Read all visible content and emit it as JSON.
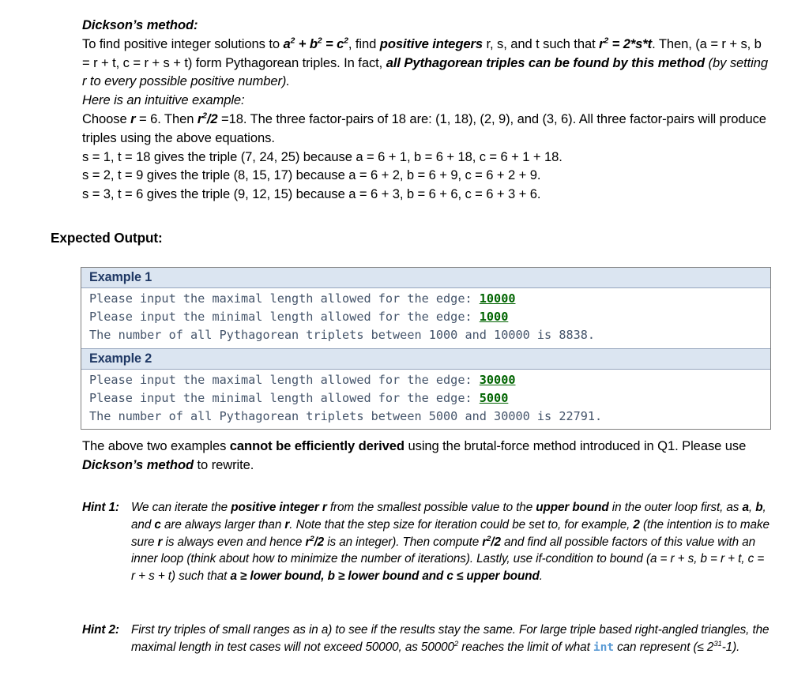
{
  "document": {
    "method": {
      "title": "Dickson’s method:",
      "line1_a": "To find positive integer solutions to ",
      "line1_eq1": "a",
      "line1_eq1_sup": "2",
      "line1_eq2": " + b",
      "line1_eq2_sup": "2",
      "line1_eq3": " = c",
      "line1_eq3_sup": "2",
      "line1_b": ", find ",
      "line1_strong": "positive integers",
      "line1_c": " r, s, and t such that ",
      "line1_eq4": "r",
      "line1_eq4_sup": "2",
      "line1_eq5": " = 2*s*t",
      "line1_d": ". Then, (a = r + s, b = r + t, c = r + s + t) form Pythagorean triples. In fact, ",
      "line1_strong2": "all Pythagorean triples can be found by this method",
      "line1_e": " (by setting r to every possible positive number).",
      "intuitive": "Here is an intuitive example:",
      "choose_a": "Choose ",
      "choose_r": "r",
      "choose_b": " = 6. Then ",
      "choose_r2": "r",
      "choose_r2_sup": "2",
      "choose_half": "/2",
      "choose_c": " =18. The three factor-pairs of 18 are: (1, 18), (2, 9), and (3, 6). All three factor-pairs will produce triples using the above equations.",
      "s_line_1": "s = 1, t = 18 gives the triple (7, 24, 25) because a = 6 + 1, b = 6 + 18, c = 6 + 1 + 18.",
      "s_line_2": "s = 2, t = 9 gives the triple (8, 15, 17) because a = 6 + 2, b = 6 + 9, c = 6 + 2 + 9.",
      "s_line_3": "s = 3, t = 6 gives the triple (9, 12, 15) because a = 6 + 3, b = 6 + 6, c = 6 + 3 + 6."
    },
    "expected_output_heading": "Expected Output:",
    "examples": [
      {
        "header": "Example 1",
        "lines": [
          {
            "prompt": "Please input the maximal length allowed for the edge: ",
            "value": "10000"
          },
          {
            "prompt": "Please input the minimal length allowed for the edge: ",
            "value": "1000"
          },
          {
            "prompt": "The number of all Pythagorean triplets between 1000 and 10000 is 8838.",
            "value": ""
          }
        ]
      },
      {
        "header": "Example 2",
        "lines": [
          {
            "prompt": "Please input the maximal length allowed for the edge: ",
            "value": "30000"
          },
          {
            "prompt": "Please input the minimal length allowed for the edge: ",
            "value": "5000"
          },
          {
            "prompt": "The number of all Pythagorean triplets between 5000 and 30000 is 22791.",
            "value": ""
          }
        ]
      }
    ],
    "below_paragraph": {
      "a": "The above two examples ",
      "bold": "cannot be efficiently derived",
      "b": " using the brutal-force method introduced in Q1. Please use ",
      "bolditalic": "Dickson’s method",
      "c": " to rewrite."
    },
    "hints": [
      {
        "label": "Hint 1:",
        "a": "We can iterate the ",
        "b1": "positive integer r",
        "b": " from the smallest possible value to the ",
        "b2": "upper bound",
        "c": " in the outer loop first, as ",
        "b3": "a",
        "c2": ", ",
        "b4": "b",
        "c3": ", and ",
        "b5": "c",
        "c4": " are always larger than ",
        "b6": "r",
        "c5": ". Note that the step size for iteration could be set to, for example, ",
        "b7": "2",
        "c6": " (the intention is to make sure ",
        "b8": "r",
        "c7": " is always even and hence ",
        "b9": "r",
        "b9sup": "2",
        "b9b": "/2",
        "c8": " is an integer). Then compute ",
        "b10": "r",
        "b10sup": "2",
        "b10b": "/2",
        "c9": " and find all possible factors of this value with an inner loop (think about how to minimize the number of iterations). Lastly, use if-condition to bound (a = r + s, b = r + t, c = r + s + t) such that ",
        "b11": "a ≥ lower bound, b ≥ lower bound and c ≤ upper bound",
        "c10": "."
      },
      {
        "label": "Hint 2:",
        "a": "First try triples of small ranges as in a) to see if the results stay the same. For large triple based right-angled triangles, the maximal length in test cases will not exceed 50000, as 50000",
        "a_sup": "2",
        "b": " reaches the limit of what ",
        "mono": "int",
        "c": " can represent (≤ 2",
        "c_sup": "31",
        "d": "-1)."
      }
    ]
  },
  "colors": {
    "code_text": "#44546a",
    "code_value": "#006400",
    "example_header_bg": "#dbe5f1",
    "example_header_text": "#1f3864",
    "int_keyword": "#5b9bd5",
    "box_border": "#7f7f7f"
  }
}
